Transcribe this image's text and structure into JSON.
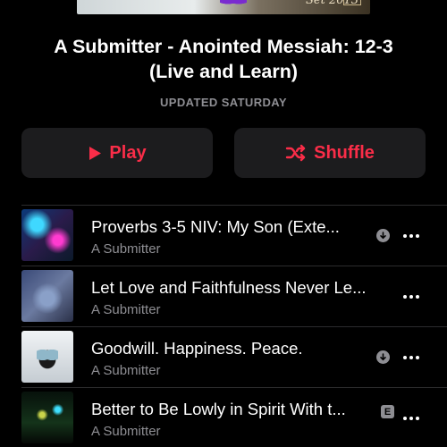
{
  "artwork": {
    "signature": "Set 2013"
  },
  "playlist": {
    "title_line1": "A Submitter - Anointed Messiah: 12-3",
    "title_line2": "(Live and Learn)",
    "updated": "UPDATED SATURDAY"
  },
  "actions": {
    "play_label": "Play",
    "shuffle_label": "Shuffle",
    "accent_color": "#fa2d48"
  },
  "tracks": [
    {
      "title": "Proverbs 3-5 NIV: My Son (Exte...",
      "artist": "A Submitter",
      "badge": "download-icon"
    },
    {
      "title": "Let Love and Faithfulness Never Le...",
      "artist": "A Submitter",
      "badge": ""
    },
    {
      "title": "Goodwill. Happiness. Peace.",
      "artist": "A Submitter",
      "badge": "download-icon"
    },
    {
      "title": "Better to Be Lowly in Spirit With t...",
      "artist": "A Submitter",
      "badge": "E"
    }
  ]
}
